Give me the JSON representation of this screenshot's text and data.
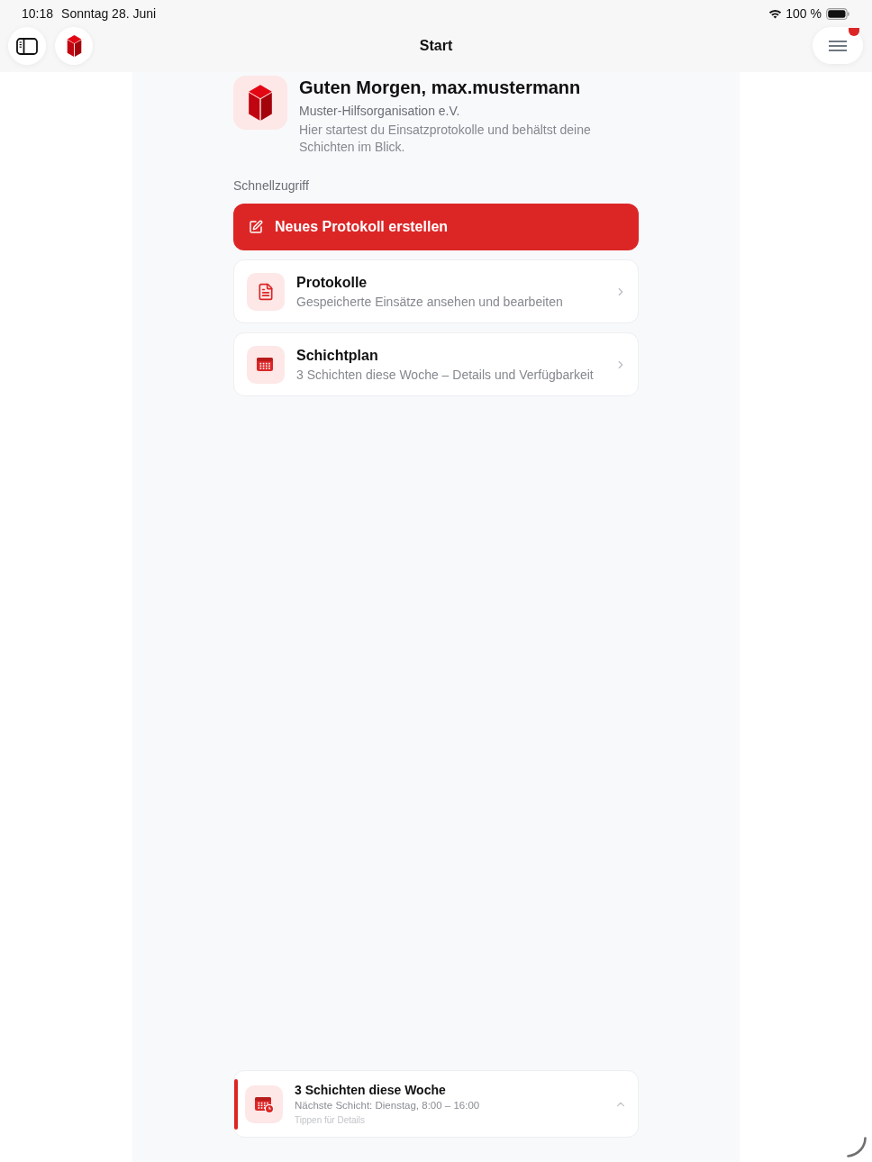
{
  "status_bar": {
    "time": "10:18",
    "date": "Sonntag 28. Juni",
    "battery": "100 %"
  },
  "nav_bar": {
    "title": "Start",
    "menu_button": {
      "badge": true
    }
  },
  "header": {
    "greeting": "Guten Morgen, max.mustermann",
    "organization": "Muster-Hilfsorganisation e.V.",
    "description": "Hier startest du Einsatzprotokolle und behältst deine Schichten im Blick."
  },
  "quick_access": {
    "heading": "Schnellzugriff",
    "primary_action": {
      "label": "Neues Protokoll erstellen"
    },
    "items": [
      {
        "kind": "document",
        "title": "Protokolle",
        "subtitle": "Gespeicherte Einsätze ansehen und bearbeiten"
      },
      {
        "kind": "calendar",
        "title": "Schichtplan",
        "subtitle": "3 Schichten diese Woche – Details und Verfügbarkeit"
      }
    ]
  },
  "shift_banner": {
    "title": "3 Schichten diese Woche",
    "subtitle": "Nächste Schicht: Dienstag, 8:00 – 16:00",
    "hint": "Tippen für Details"
  }
}
